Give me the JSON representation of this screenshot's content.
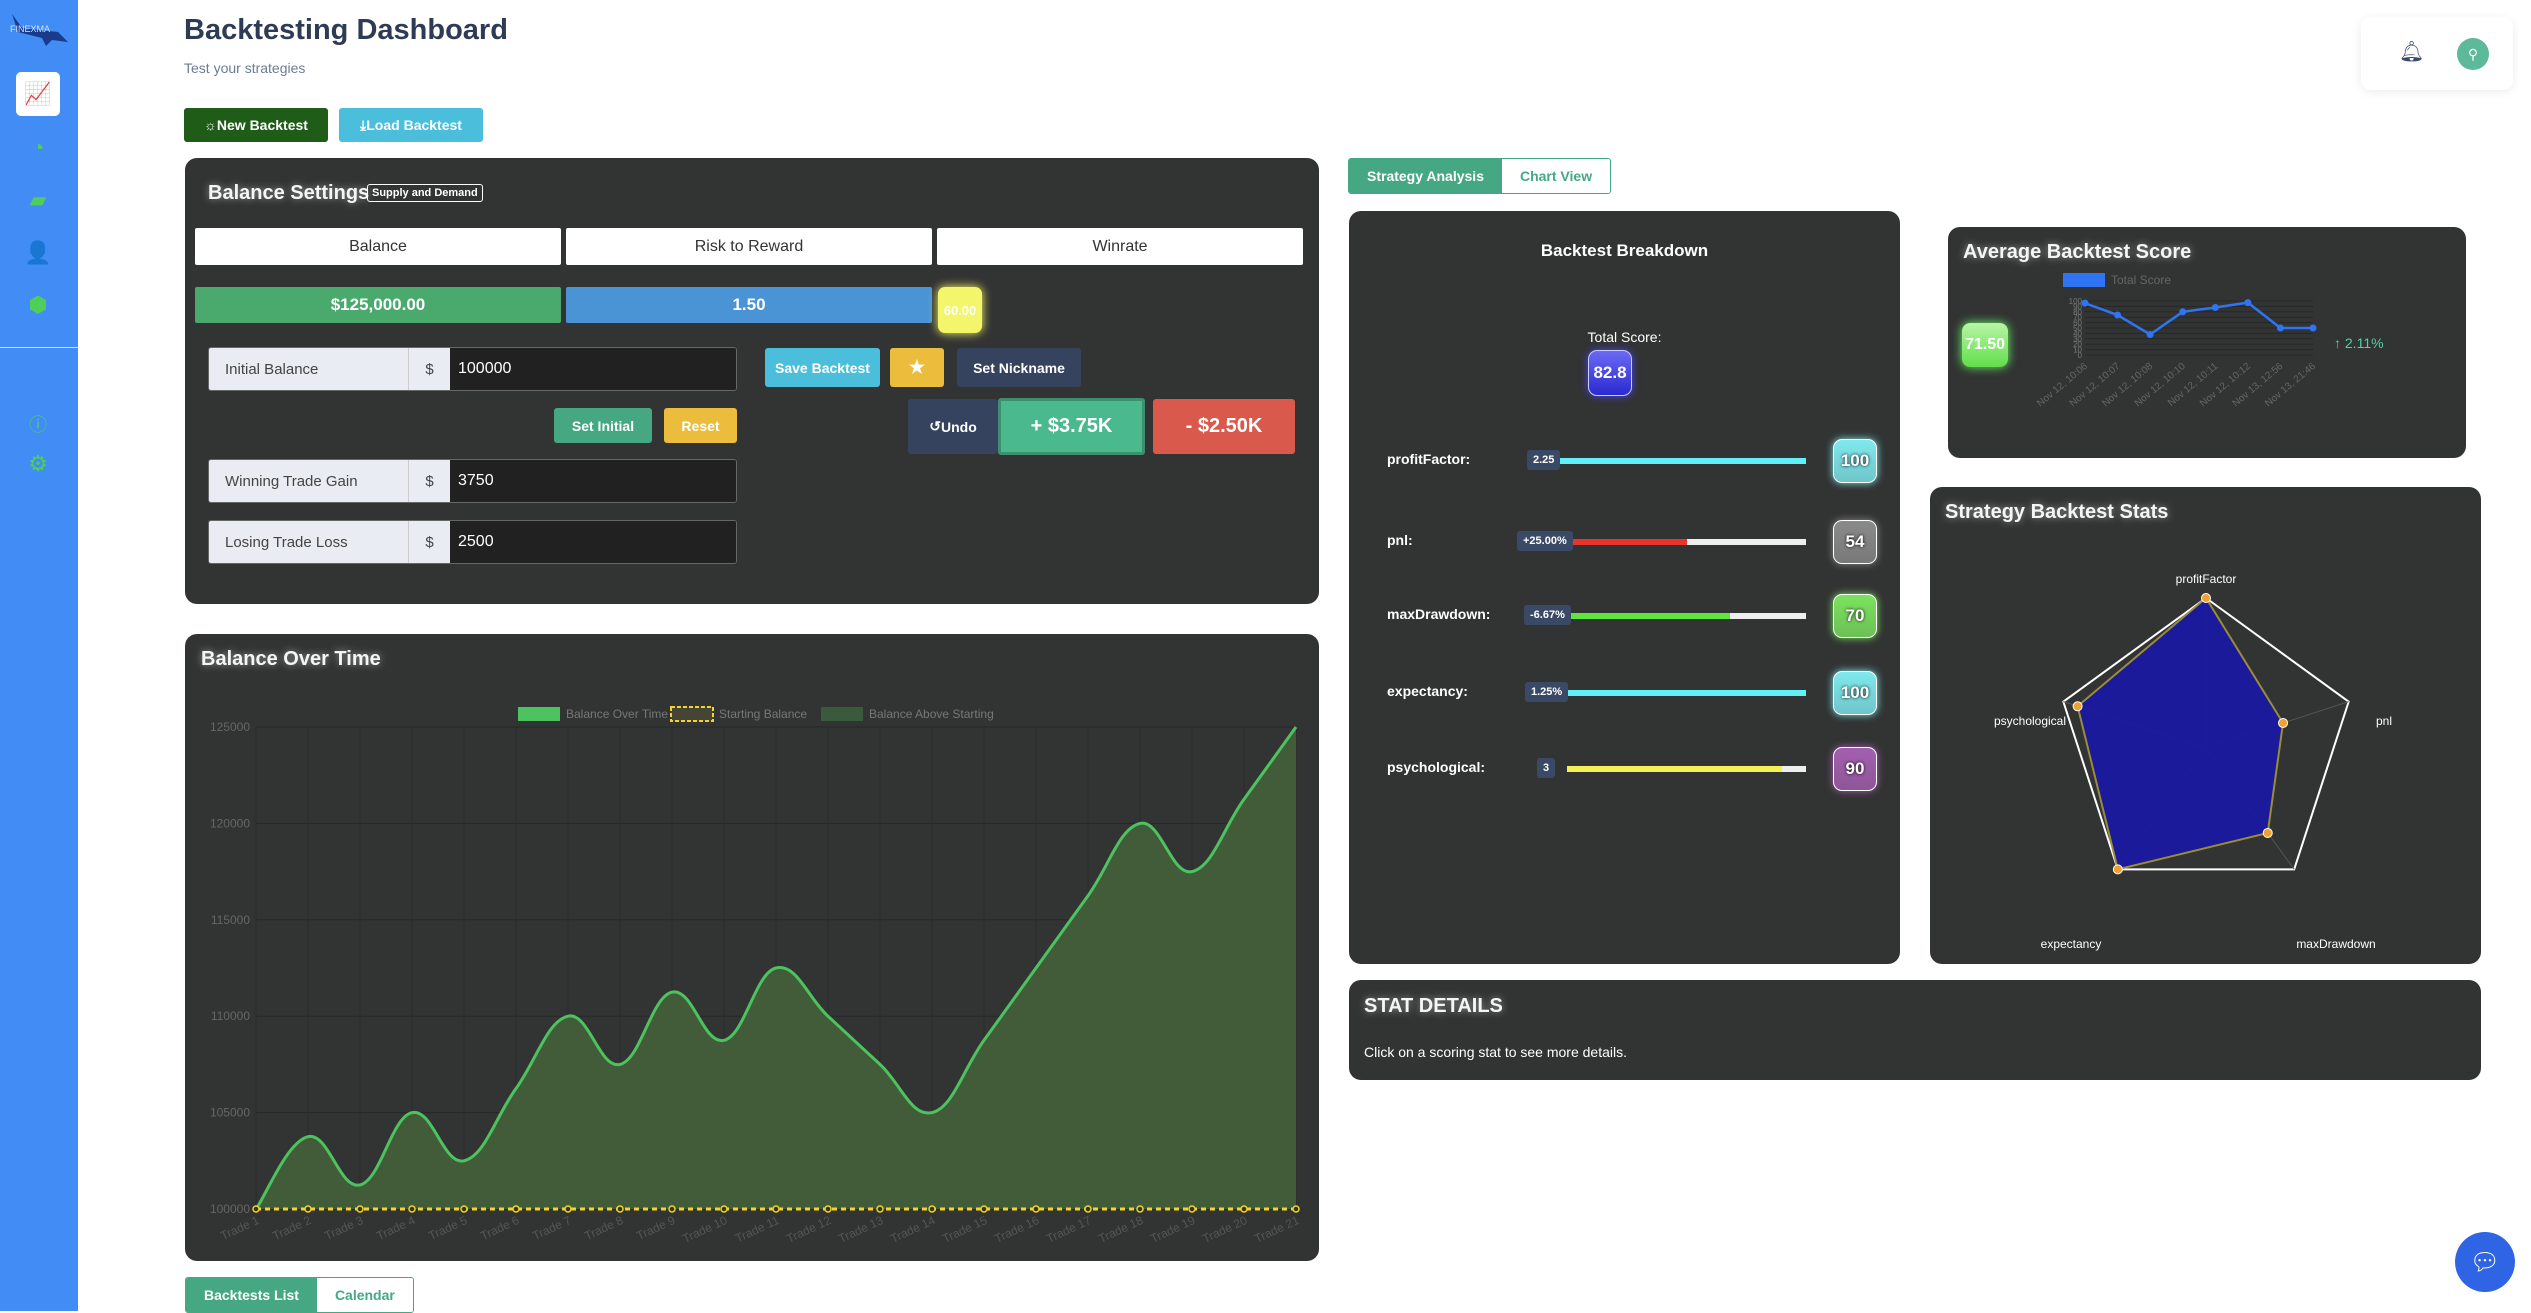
{
  "sidebar": {
    "logo_text": "FINEXMA",
    "items": [
      {
        "icon": "chart-growth-icon",
        "active": true
      },
      {
        "icon": "gauge-icon"
      },
      {
        "icon": "wallet-icon"
      },
      {
        "icon": "user-cog-icon"
      },
      {
        "icon": "box-icon"
      }
    ],
    "bottom_items": [
      {
        "icon": "help-icon"
      },
      {
        "icon": "gear-icon"
      }
    ]
  },
  "header": {
    "title": "Backtesting Dashboard",
    "subtitle": "Test your strategies",
    "new_backtest": "New Backtest",
    "load_backtest": "Load Backtest"
  },
  "balance_settings": {
    "title": "Balance Settings",
    "strategy_badge": "Supply and Demand",
    "columns": [
      "Balance",
      "Risk to Reward",
      "Winrate"
    ],
    "balance_value": "$125,000.00",
    "rr_value": "1.50",
    "winrate_value": "60.00",
    "initial_label": "Initial Balance",
    "initial_value": "100000",
    "currency": "$",
    "set_initial": "Set Initial",
    "reset": "Reset",
    "win_label": "Winning Trade Gain",
    "win_value": "3750",
    "loss_label": "Losing Trade Loss",
    "loss_value": "2500",
    "save_backtest": "Save Backtest",
    "set_nickname": "Set Nickname",
    "undo": "Undo",
    "add_win": "+ $3.75K",
    "add_loss": "- $2.50K"
  },
  "colors": {
    "green": "#4aa96c",
    "blue": "#4a94d6",
    "yellow": "#ecbd3c",
    "win": "#4ab98e",
    "loss": "#d9594c",
    "panel": "#323333"
  },
  "balance_chart": {
    "title": "Balance Over Time"
  },
  "chart_data": [
    {
      "type": "line",
      "title": "Balance Over Time",
      "legend": [
        "Balance Over Time",
        "Starting Balance",
        "Balance Above Starting"
      ],
      "legend_placement": "top",
      "categories": [
        "Trade 1",
        "Trade 2",
        "Trade 3",
        "Trade 4",
        "Trade 5",
        "Trade 6",
        "Trade 7",
        "Trade 8",
        "Trade 9",
        "Trade 10",
        "Trade 11",
        "Trade 12",
        "Trade 13",
        "Trade 14",
        "Trade 15",
        "Trade 16",
        "Trade 17",
        "Trade 18",
        "Trade 19",
        "Trade 20",
        "Trade 21"
      ],
      "series": [
        {
          "name": "Balance Over Time",
          "values": [
            100000,
            103750,
            101250,
            105000,
            102500,
            106250,
            110000,
            107500,
            111250,
            108750,
            112500,
            110000,
            107500,
            105000,
            108750,
            112500,
            116250,
            120000,
            117500,
            121250,
            125000
          ]
        },
        {
          "name": "Starting Balance",
          "values": [
            100000,
            100000,
            100000,
            100000,
            100000,
            100000,
            100000,
            100000,
            100000,
            100000,
            100000,
            100000,
            100000,
            100000,
            100000,
            100000,
            100000,
            100000,
            100000,
            100000,
            100000
          ]
        }
      ],
      "yticks": [
        100000,
        105000,
        110000,
        115000,
        120000,
        125000
      ],
      "ylim": [
        100000,
        125000
      ],
      "grid": true
    },
    {
      "type": "line",
      "title": "Average Backtest Score",
      "legend": [
        "Total Score"
      ],
      "legend_placement": "top",
      "categories": [
        "Nov 12, 10:06",
        "Nov 12, 10:07",
        "Nov 12, 10:08",
        "Nov 12, 10:10",
        "Nov 12, 10:11",
        "Nov 12, 10:12",
        "Nov 13, 12:56",
        "Nov 13, 21:46"
      ],
      "series": [
        {
          "name": "Total Score",
          "values": [
            96,
            74,
            38,
            80,
            88,
            97,
            50,
            50
          ]
        }
      ],
      "yticks": [
        0,
        10,
        20,
        30,
        40,
        50,
        60,
        70,
        80,
        90,
        100
      ],
      "ylim": [
        0,
        100
      ],
      "grid": true
    },
    {
      "type": "radar",
      "title": "Strategy Backtest Stats",
      "categories": [
        "profitFactor",
        "pnl",
        "maxDrawdown",
        "expectancy",
        "psychological"
      ],
      "values": [
        100,
        54,
        70,
        100,
        90
      ],
      "rlim": [
        0,
        100
      ]
    }
  ],
  "tabs": {
    "analysis": "Strategy Analysis",
    "chart_view": "Chart View",
    "list": "Backtests List",
    "calendar": "Calendar"
  },
  "breakdown": {
    "title": "Backtest Breakdown",
    "total_label": "Total Score:",
    "total": "82.8",
    "rows": [
      {
        "label": "profitFactor:",
        "chip": "2.25",
        "score": "100",
        "pct": 100,
        "bar": "#5ff1f5",
        "badge": "#7fe9ee"
      },
      {
        "label": "pnl:",
        "chip": "+25.00%",
        "score": "54",
        "pct": 54,
        "bar": "#e8342a",
        "badge": "#8a8a8a"
      },
      {
        "label": "maxDrawdown:",
        "chip": "-6.67%",
        "score": "70",
        "pct": 70,
        "bar": "#5ee63a",
        "badge": "#7be35e"
      },
      {
        "label": "expectancy:",
        "chip": "1.25%",
        "score": "100",
        "pct": 100,
        "bar": "#5ff1f5",
        "badge": "#7fe9ee"
      },
      {
        "label": "psychological:",
        "chip": "3",
        "score": "90",
        "pct": 90,
        "bar": "#f5f154",
        "badge": "#a45fb0"
      }
    ]
  },
  "avg_score": {
    "title": "Average Backtest Score",
    "value": "71.50",
    "change": "2.11%"
  },
  "stats": {
    "title": "Strategy Backtest Stats"
  },
  "details": {
    "title": "STAT DETAILS",
    "text": "Click on a scoring stat to see more details."
  }
}
